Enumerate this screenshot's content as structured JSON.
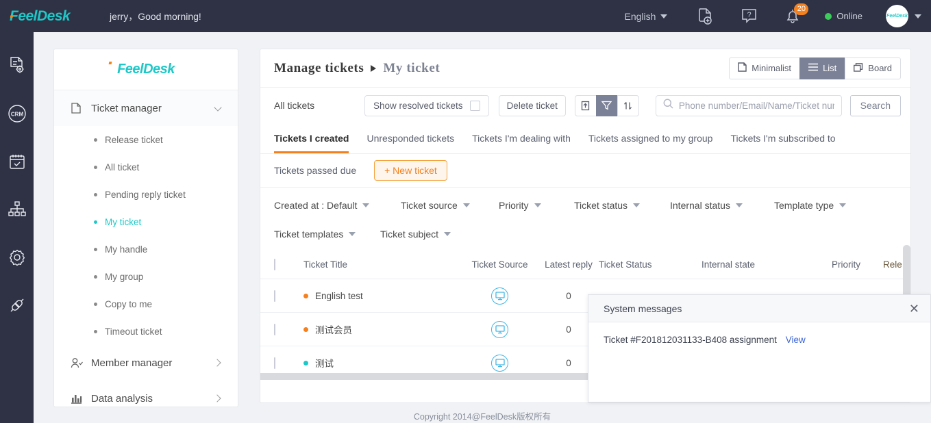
{
  "topbar": {
    "brand": "FeelDesk",
    "greeting": "jerry，Good morning!",
    "language": "English",
    "icons": [
      {
        "name": "new-document-icon"
      },
      {
        "name": "help-icon"
      },
      {
        "name": "bell-icon"
      }
    ],
    "notification_count": "20",
    "status": "Online",
    "avatar_text": "FeelDesk"
  },
  "rail": {
    "items": [
      {
        "name": "ticket-settings-icon"
      },
      {
        "name": "crm-icon",
        "label": "CRM"
      },
      {
        "name": "calendar-check-icon"
      },
      {
        "name": "org-chart-icon"
      },
      {
        "name": "gear-icon"
      },
      {
        "name": "plug-connect-icon"
      }
    ]
  },
  "sidebar": {
    "logo": "FeelDesk",
    "groups": [
      {
        "label": "Ticket manager",
        "icon": "clipboard-icon",
        "expanded": true,
        "items": [
          {
            "label": "Release ticket",
            "current": false
          },
          {
            "label": "All ticket",
            "current": false
          },
          {
            "label": "Pending reply ticket",
            "current": false
          },
          {
            "label": "My ticket",
            "current": true
          },
          {
            "label": "My handle",
            "current": false
          },
          {
            "label": "My group",
            "current": false
          },
          {
            "label": "Copy to me",
            "current": false
          },
          {
            "label": "Timeout ticket",
            "current": false
          }
        ]
      },
      {
        "label": "Member manager",
        "icon": "users-icon",
        "expanded": false,
        "items": []
      },
      {
        "label": "Data analysis",
        "icon": "bar-chart-icon",
        "expanded": false,
        "items": []
      }
    ]
  },
  "main": {
    "breadcrumb": {
      "root": "Manage tickets",
      "leaf": "My ticket"
    },
    "view_toggle": [
      {
        "label": "Minimalist",
        "icon": "note-icon",
        "active": false
      },
      {
        "label": "List",
        "icon": "list-icon",
        "active": true
      },
      {
        "label": "Board",
        "icon": "board-icon",
        "active": false
      }
    ],
    "toolbar": {
      "scope_label": "All tickets",
      "show_resolved_label": "Show resolved tickets",
      "show_resolved_checked": false,
      "delete_label": "Delete ticket",
      "icon_buttons": [
        {
          "name": "export-icon",
          "active": false
        },
        {
          "name": "filter-icon",
          "active": true
        },
        {
          "name": "sort-icon",
          "active": false
        }
      ],
      "search_placeholder": "Phone number/Email/Name/Ticket number/Pro",
      "search_value": "",
      "search_button": "Search"
    },
    "tabs": [
      {
        "label": "Tickets I created",
        "active": true
      },
      {
        "label": "Unresponded tickets",
        "active": false
      },
      {
        "label": "Tickets I'm dealing with",
        "active": false
      },
      {
        "label": "Tickets assigned to my group",
        "active": false
      },
      {
        "label": "Tickets I'm subscribed to",
        "active": false
      }
    ],
    "tabs_row2": [
      {
        "label": "Tickets passed due",
        "active": false
      }
    ],
    "new_ticket_button": "+ New ticket",
    "filters": [
      {
        "label": "Created at : Default"
      },
      {
        "label": "Ticket source"
      },
      {
        "label": "Priority"
      },
      {
        "label": "Ticket status"
      },
      {
        "label": "Internal status"
      },
      {
        "label": "Template type"
      },
      {
        "label": "Ticket templates"
      },
      {
        "label": "Ticket subject"
      }
    ],
    "table": {
      "columns": [
        {
          "key": "title",
          "label": "Ticket Title"
        },
        {
          "key": "source",
          "label": "Ticket Source"
        },
        {
          "key": "reply",
          "label": "Latest reply"
        },
        {
          "key": "status",
          "label": "Ticket Status"
        },
        {
          "key": "internal",
          "label": "Internal state"
        },
        {
          "key": "priority",
          "label": "Priority"
        },
        {
          "key": "release",
          "label": "Rele"
        }
      ],
      "rows": [
        {
          "title": "English test",
          "dot_color": "#f5811e",
          "source_icon": "monitor-icon",
          "reply": "0"
        },
        {
          "title": "测试会员",
          "dot_color": "#f5811e",
          "source_icon": "monitor-icon",
          "reply": "0"
        },
        {
          "title": "测试",
          "dot_color": "#1ec8c8",
          "source_icon": "monitor-icon",
          "reply": "0"
        }
      ]
    }
  },
  "system_messages": {
    "title": "System messages",
    "close_label": "✕",
    "message": "Ticket #F201812031133-B408 assignment",
    "link_label": "View"
  },
  "footer": {
    "copyright": "Copyright 2014@FeelDesk版权所有"
  }
}
